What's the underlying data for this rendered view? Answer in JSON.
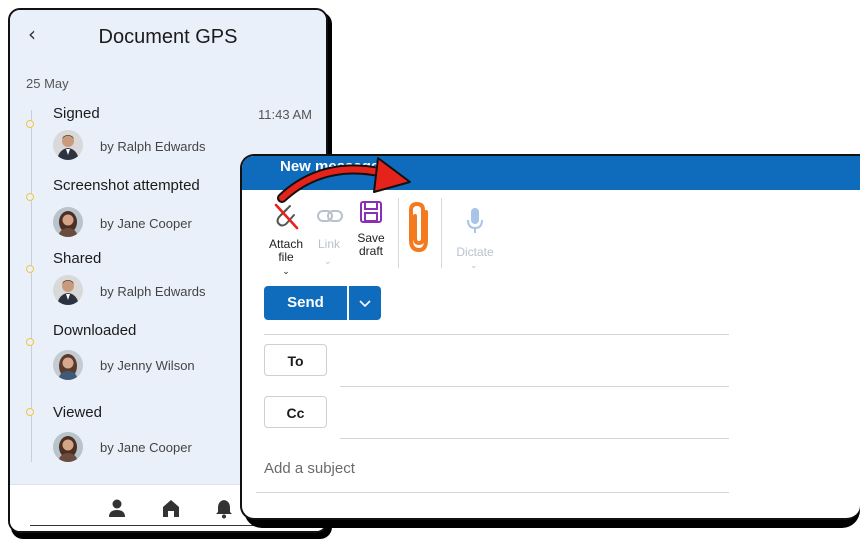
{
  "gps": {
    "back_icon": "chevron-left-icon",
    "title": "Document GPS",
    "date": "25 May",
    "events": [
      {
        "title": "Signed",
        "time": "11:43 AM",
        "by": "by Ralph Edwards"
      },
      {
        "title": "Screenshot attempted",
        "by": "by Jane Cooper"
      },
      {
        "title": "Shared",
        "by": "by Ralph Edwards"
      },
      {
        "title": "Downloaded",
        "by": "by Jenny Wilson"
      },
      {
        "title": "Viewed",
        "by": "by Jane Cooper"
      }
    ],
    "bottom_nav": [
      "person-icon",
      "home-icon",
      "bell-icon"
    ]
  },
  "message": {
    "title": "New message",
    "toolbar": {
      "attach": "Attach file",
      "link": "Link",
      "save": "Save draft",
      "dictate": "Dictate"
    },
    "send_label": "Send",
    "to_label": "To",
    "cc_label": "Cc",
    "subject_placeholder": "Add a subject"
  },
  "colors": {
    "brand_blue": "#0f6cbd",
    "highlight_orange": "#f47a20",
    "arrow_red": "#e5231b",
    "timeline_yellow": "#f0c541",
    "panel_bg": "#eaf0f9"
  }
}
